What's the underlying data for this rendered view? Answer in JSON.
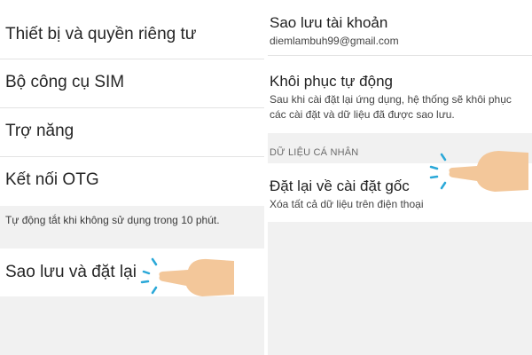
{
  "left_panel": {
    "items": [
      {
        "label": "Thiết bị và quyền riêng tư"
      },
      {
        "label": "Bộ công cụ SIM"
      },
      {
        "label": "Trợ năng"
      },
      {
        "label": "Kết nối OTG"
      }
    ],
    "otg_note": "Tự động tắt khi không sử dụng trong 10 phút.",
    "backup_reset": {
      "label": "Sao lưu và đặt lại"
    }
  },
  "right_panel": {
    "backup_account": {
      "title": "Sao lưu tài khoản",
      "email": "diemlambuh99@gmail.com"
    },
    "auto_restore": {
      "title": "Khôi phục tự động",
      "desc_line1": "Sau khi cài đặt lại ứng dụng, hệ thống sẽ khôi phục",
      "desc_line2": "các cài đặt và dữ liệu đã được sao lưu."
    },
    "section_header": "DỮ LIỆU CÁ NHÂN",
    "factory_reset": {
      "title": "Đặt lại về cài đặt gốc",
      "desc": "Xóa tất cả dữ liệu trên điện thoại"
    }
  },
  "colors": {
    "background": "#f1f1f1",
    "row": "#ffffff",
    "text": "#262626",
    "tap_accent": "#2aa8d8",
    "finger": "#f3c79a"
  },
  "icons": [
    "pointing-hand-icon",
    "tap-indicator-icon"
  ]
}
